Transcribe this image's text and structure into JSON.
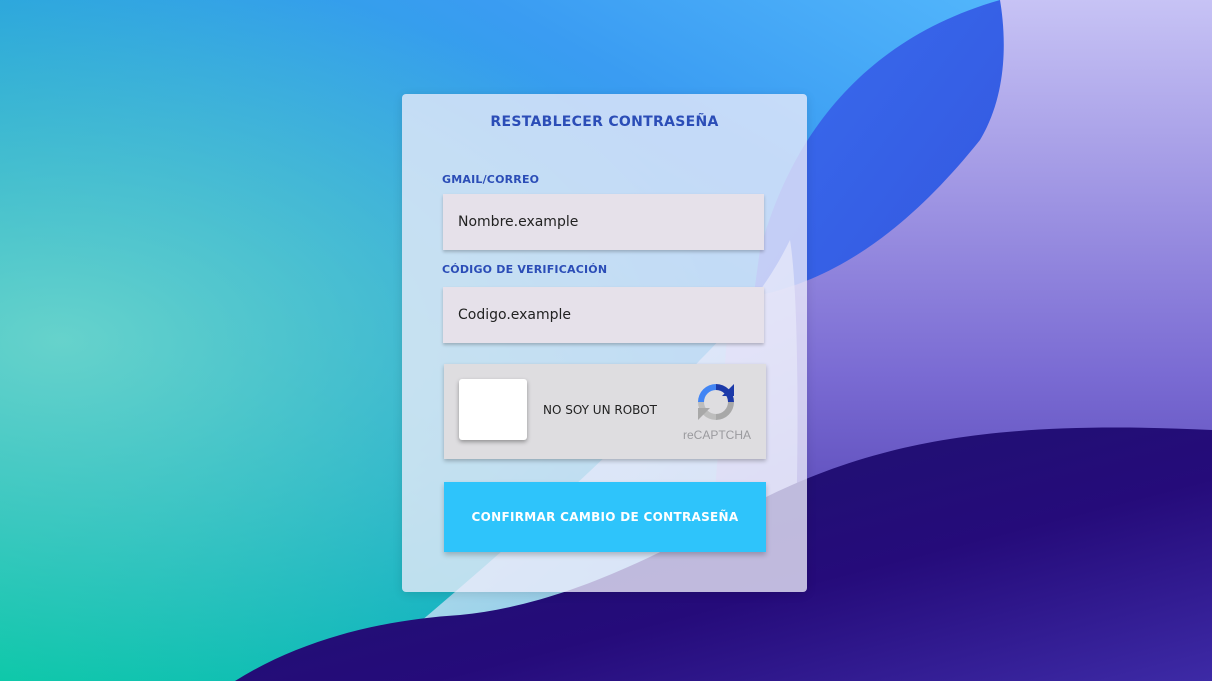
{
  "form": {
    "title": "RESTABLECER CONTRASEÑA",
    "email_label": "GMAIL/CORREO",
    "email_placeholder": "Nombre.example",
    "code_label": "CÓDIGO DE VERIFICACIÓN",
    "code_placeholder": "Codigo.example",
    "submit_label": "CONFIRMAR CAMBIO DE CONTRASEÑA"
  },
  "captcha": {
    "label": "NO SOY UN ROBOT",
    "brand": "reCAPTCHA",
    "logo_icon": "recaptcha-icon",
    "checked": false
  },
  "colors": {
    "accent_text": "#2b4db7",
    "button": "#2ec4fb",
    "input_bg": "#e6e1ea"
  }
}
